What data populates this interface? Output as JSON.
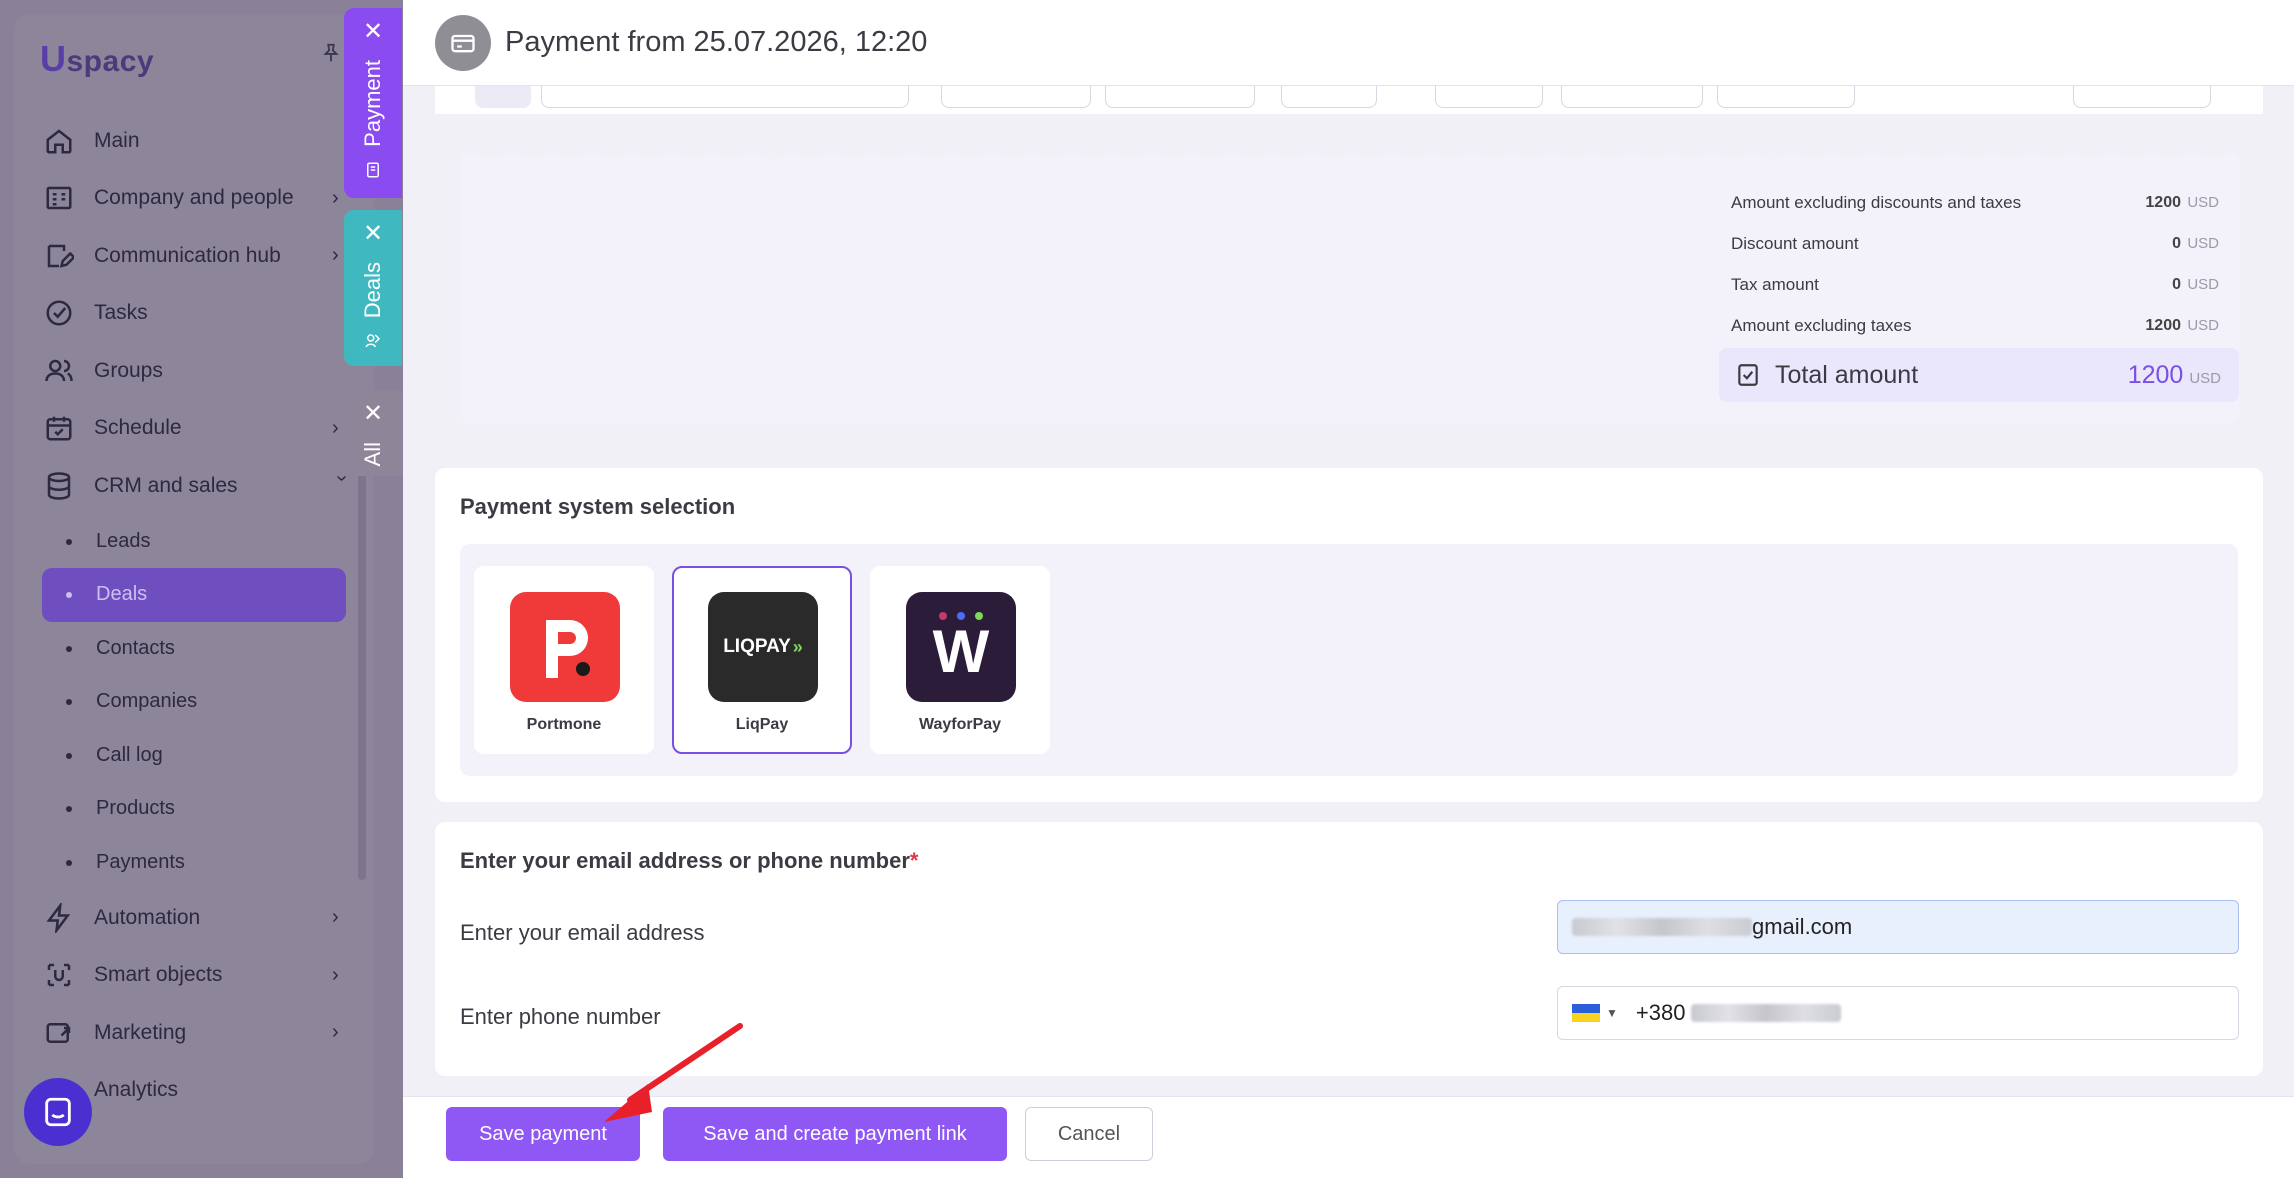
{
  "sidebar": {
    "logo": "spacy",
    "logo_mark": "U",
    "items": [
      {
        "label": "Main",
        "icon": "home-icon"
      },
      {
        "label": "Company and people",
        "icon": "company-icon",
        "chevron": true
      },
      {
        "label": "Communication hub",
        "icon": "chat-edit-icon",
        "chevron": true
      },
      {
        "label": "Tasks",
        "icon": "check-circle-icon"
      },
      {
        "label": "Groups",
        "icon": "users-icon"
      },
      {
        "label": "Schedule",
        "icon": "calendar-icon",
        "chevron": true
      },
      {
        "label": "CRM and sales",
        "icon": "database-icon",
        "chevron": true,
        "expanded": true
      }
    ],
    "crm_sub": [
      "Leads",
      "Deals",
      "Contacts",
      "Companies",
      "Call log",
      "Products",
      "Payments"
    ],
    "items_after": [
      {
        "label": "Automation",
        "icon": "lightning-icon",
        "chevron": true
      },
      {
        "label": "Smart objects",
        "icon": "smart-object-icon",
        "chevron": true
      },
      {
        "label": "Marketing",
        "icon": "marketing-icon",
        "chevron": true
      },
      {
        "label": "Analytics",
        "icon": "analytics-icon"
      }
    ]
  },
  "side_tabs": {
    "payment": "Payment",
    "deals": "Deals",
    "all": "All"
  },
  "header": {
    "title": "Payment from 25.07.2026, 12:20"
  },
  "totals": {
    "rows": [
      {
        "label": "Amount excluding discounts and taxes",
        "value": "1200",
        "currency": "USD"
      },
      {
        "label": "Discount amount",
        "value": "0",
        "currency": "USD"
      },
      {
        "label": "Tax amount",
        "value": "0",
        "currency": "USD"
      },
      {
        "label": "Amount excluding taxes",
        "value": "1200",
        "currency": "USD"
      }
    ],
    "total_label": "Total amount",
    "total_value": "1200",
    "total_currency": "USD"
  },
  "payment_system": {
    "title": "Payment system selection",
    "providers": [
      {
        "name": "Portmone",
        "selected": false
      },
      {
        "name": "LiqPay",
        "selected": true,
        "logo_text": "LIQPAY"
      },
      {
        "name": "WayforPay",
        "selected": false,
        "logo_text": "W"
      }
    ]
  },
  "contact": {
    "title": "Enter your email address or phone number",
    "required_mark": "*",
    "email_label": "Enter your email address",
    "email_value_visible": "gmail.com",
    "phone_label": "Enter phone number",
    "phone_prefix": "+380"
  },
  "footer": {
    "save": "Save payment",
    "save_link": "Save and create payment link",
    "cancel": "Cancel"
  },
  "colors": {
    "accent": "#8f57f4",
    "payment_tab": "#8a4cf0",
    "deals_tab": "#3fb9bf",
    "portmone_red": "#f03a3a",
    "arrow_red": "#e8202a"
  }
}
